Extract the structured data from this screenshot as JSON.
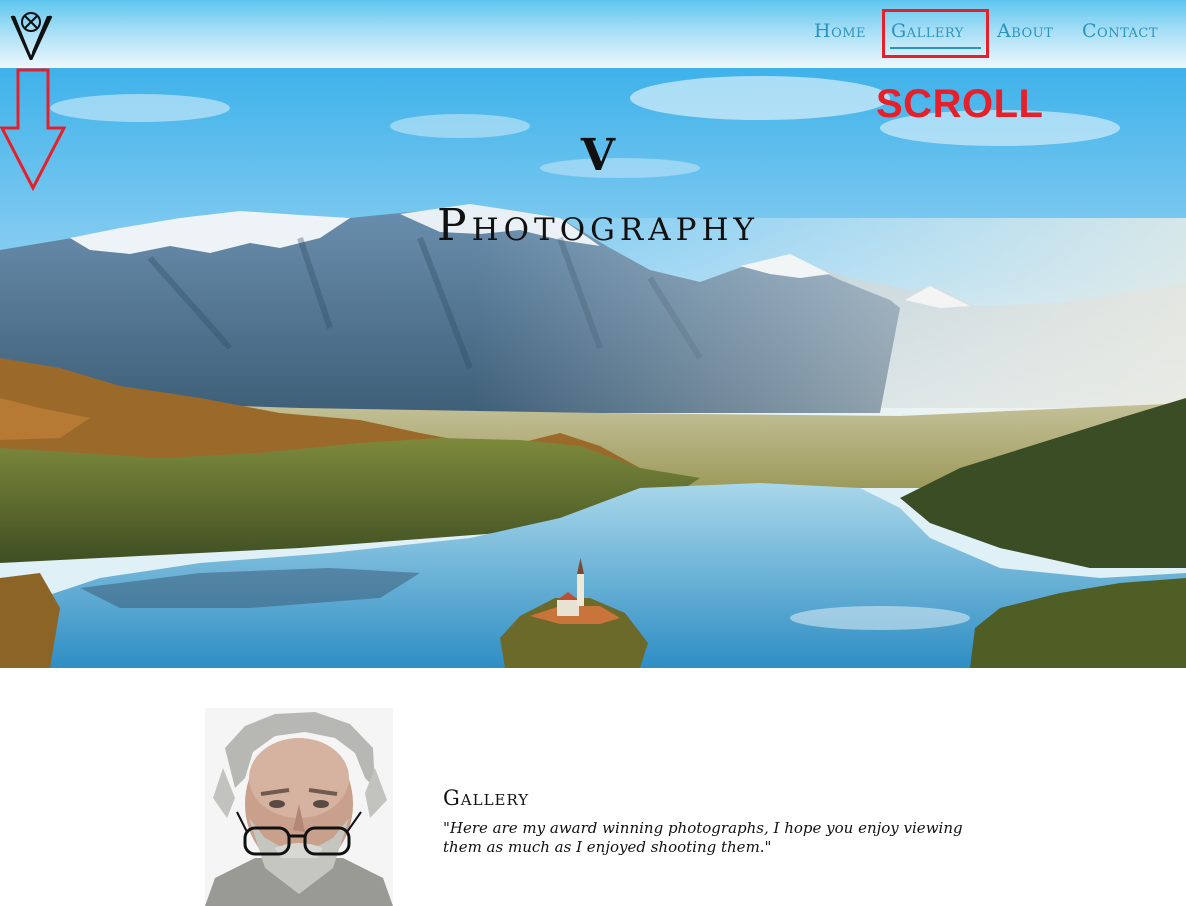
{
  "site": {
    "logo_icon": "v-logo-icon"
  },
  "nav": {
    "items": [
      {
        "label": "Home"
      },
      {
        "label": "Gallery",
        "active": true
      },
      {
        "label": "About"
      },
      {
        "label": "Contact"
      }
    ],
    "highlight_color": "#e5202b",
    "link_color": "#2a94c0"
  },
  "hero": {
    "title_line1": "V",
    "title_line2": "Photography",
    "annotation_label": "SCROLL",
    "annotation_icon": "down-arrow-icon",
    "annotation_color": "#e5202b"
  },
  "about": {
    "title": "Gallery",
    "quote": "\"Here are my award winning photographs, I hope you enjoy viewing them as much as I enjoyed shooting them.\""
  }
}
